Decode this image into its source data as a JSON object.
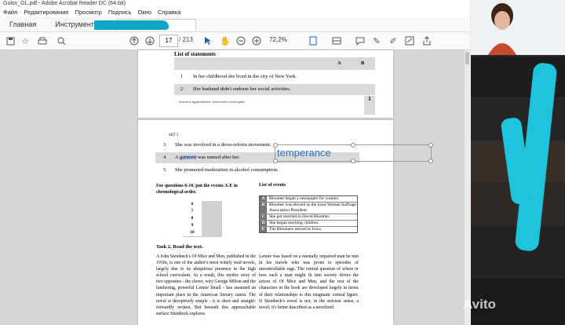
{
  "window": {
    "title": "Gulov_GL.pdf - Adobe Acrobat Reader DC (64-bit)"
  },
  "menu": [
    "Файл",
    "Редактирование",
    "Просмотр",
    "Подпись",
    "Окно",
    "Справка"
  ],
  "tabs": {
    "home": "Главная",
    "tools": "Инструменты"
  },
  "toolbar": {
    "page_current": "17",
    "page_total": "/ 213",
    "zoom": "72,2%"
  },
  "page1": {
    "title": "List of statements",
    "col_a": "A",
    "col_b": "B",
    "rows": [
      {
        "n": "1",
        "text": "In her childhood she lived in the city of New York."
      },
      {
        "n": "2",
        "text": "Her husband didn't endorse her social activities."
      }
    ],
    "note": "Ключи и аудиозаписи: www.teche.com/english",
    "side": "1"
  },
  "page2": {
    "set": "SET 3",
    "rows": [
      {
        "n": "3",
        "text": "She was involved in a dress-reform movement."
      },
      {
        "n": "4",
        "pre": "A ",
        "highlight": "garment",
        "post": " was named after her."
      },
      {
        "n": "5",
        "text": "She promoted moderation in alcohol consumption."
      }
    ],
    "textbox": "temperance",
    "q_left": "For questions 6-10, put the events A-E in chronological order.",
    "q_right": "List of events",
    "numbers": [
      "6",
      "7",
      "8",
      "9",
      "10"
    ],
    "events": [
      {
        "l": "A",
        "d": "Bloomer began a newspaper for women."
      },
      {
        "l": "B",
        "d": "Bloomer was elected as the Iowa Woman Suffrage Association President."
      },
      {
        "l": "C",
        "d": "She got married to David Bloomer."
      },
      {
        "l": "D",
        "d": "She began teaching children."
      },
      {
        "l": "E",
        "d": "The Bloomers moved to Iowa."
      }
    ],
    "task2": "Task 2. Read the text.",
    "col_left": "A John Steinbeck's Of Mice and Men, published in the 1930s, is one of the author's most widely read novels, largely due to its ubiquitous presence in the high school curriculum. As a result, this mythic story of two opposites - the clever, wiry George Milton and the lumbering, powerful Lennie Small - has assumed an important place in the American literary canon. The novel is deceptively simple - it is short and straight-forwardly written. But beneath this approachable surface Steinbeck explores",
    "col_right": "Lennie was based on a mentally impaired man he met in his travels who was prone to episodes of uncontrollable rage. The central question of where or how such a man might fit into society drives the action of Of Mice and Men, and the rest of the characters in the book are developed largely in terms of their relationships to this enigmatic central figure. D Steinbeck's novel is not, in the strictest sense, a novel; it's better described as a novelized"
  },
  "watermark": "Avito",
  "colors": {
    "accent_blue": "#2a6ebf",
    "scribble": "#1ec3dd"
  }
}
